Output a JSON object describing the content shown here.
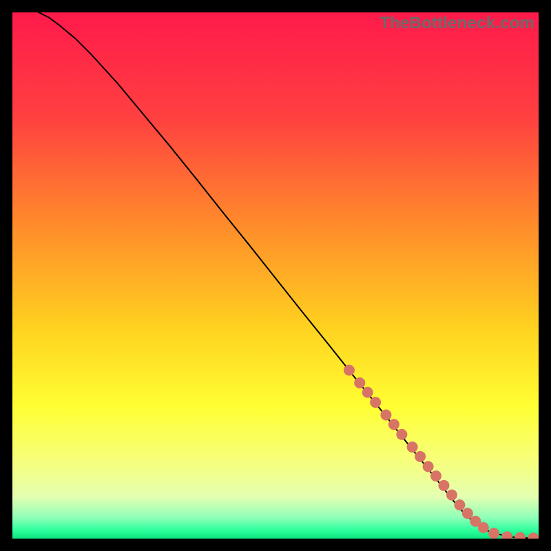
{
  "watermark": "TheBottleneck.com",
  "chart_data": {
    "type": "line",
    "title": "",
    "xlabel": "",
    "ylabel": "",
    "xlim": [
      0,
      100
    ],
    "ylim": [
      0,
      100
    ],
    "grid": false,
    "legend": false,
    "gradient_stops": [
      {
        "offset": 0.0,
        "color": "#ff1a4b"
      },
      {
        "offset": 0.2,
        "color": "#ff4040"
      },
      {
        "offset": 0.4,
        "color": "#ff8a2b"
      },
      {
        "offset": 0.6,
        "color": "#ffd21f"
      },
      {
        "offset": 0.75,
        "color": "#ffff33"
      },
      {
        "offset": 0.85,
        "color": "#f7ff7a"
      },
      {
        "offset": 0.92,
        "color": "#e4ffb0"
      },
      {
        "offset": 0.96,
        "color": "#8fffb8"
      },
      {
        "offset": 0.985,
        "color": "#2bff9c"
      },
      {
        "offset": 1.0,
        "color": "#0be37e"
      }
    ],
    "series": [
      {
        "name": "curve",
        "stroke": "#000000",
        "stroke_width": 2,
        "x": [
          5,
          7,
          9,
          12,
          15,
          20,
          25,
          30,
          35,
          40,
          45,
          50,
          55,
          60,
          65,
          70,
          75,
          80,
          85,
          88,
          90,
          92,
          95,
          98,
          100
        ],
        "y": [
          100,
          99,
          97.5,
          95,
          92,
          86.5,
          80.5,
          74.5,
          68.3,
          62,
          55.8,
          49.5,
          43.2,
          37,
          30.7,
          24.5,
          18.2,
          12,
          5.7,
          2.8,
          1.6,
          0.9,
          0.3,
          0.1,
          0.05
        ]
      }
    ],
    "markers": {
      "name": "highlight-dots",
      "color": "#d87466",
      "radius": 8,
      "x": [
        64,
        66,
        67.5,
        69,
        71,
        72.5,
        74,
        76,
        77.5,
        79,
        80.5,
        82,
        83.5,
        85,
        86.5,
        88,
        89.5,
        91.5,
        94,
        96.5,
        99
      ],
      "y": [
        32,
        29.6,
        27.8,
        25.9,
        23.5,
        21.7,
        19.8,
        17.4,
        15.6,
        13.7,
        11.9,
        10.1,
        8.3,
        6.4,
        4.8,
        3.3,
        2.1,
        1.0,
        0.35,
        0.2,
        0.1
      ]
    }
  }
}
